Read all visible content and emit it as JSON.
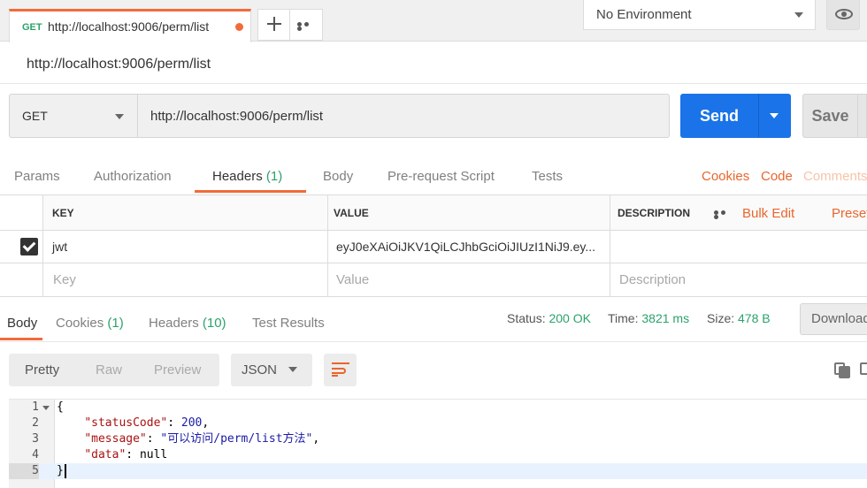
{
  "top_tabs": {
    "active_tab": {
      "method": "GET",
      "url": "http://localhost:9006/perm/list",
      "unsaved": true
    },
    "environment": {
      "selected": "No Environment"
    }
  },
  "request": {
    "title": "http://localhost:9006/perm/list",
    "method": "GET",
    "url": "http://localhost:9006/perm/list",
    "send_label": "Send",
    "save_label": "Save"
  },
  "request_tabs": {
    "items": [
      {
        "label": "Params",
        "count": ""
      },
      {
        "label": "Authorization",
        "count": ""
      },
      {
        "label": "Headers",
        "count": "(1)"
      },
      {
        "label": "Body",
        "count": ""
      },
      {
        "label": "Pre-request Script",
        "count": ""
      },
      {
        "label": "Tests",
        "count": ""
      }
    ],
    "active": "Headers",
    "links": {
      "cookies": "Cookies",
      "code": "Code",
      "comments": "Comments"
    }
  },
  "headers_table": {
    "columns": {
      "key": "KEY",
      "value": "VALUE",
      "description": "DESCRIPTION"
    },
    "bulk_edit": "Bulk Edit",
    "presets": "Presets",
    "rows": [
      {
        "checked": true,
        "key": "jwt",
        "value": "eyJ0eXAiOiJKV1QiLCJhbGciOiJIUzI1NiJ9.ey...",
        "description": ""
      }
    ],
    "placeholders": {
      "key": "Key",
      "value": "Value",
      "description": "Description"
    }
  },
  "response": {
    "tabs": [
      {
        "label": "Body",
        "count": ""
      },
      {
        "label": "Cookies",
        "count": "(1)"
      },
      {
        "label": "Headers",
        "count": "(10)"
      },
      {
        "label": "Test Results",
        "count": ""
      }
    ],
    "active": "Body",
    "status_label": "Status:",
    "status_value": "200 OK",
    "time_label": "Time:",
    "time_value": "3821 ms",
    "size_label": "Size:",
    "size_value": "478 B",
    "download_label": "Download",
    "view_modes": [
      "Pretty",
      "Raw",
      "Preview"
    ],
    "active_view": "Pretty",
    "format": "JSON",
    "code": {
      "line_numbers": [
        "1",
        "2",
        "3",
        "4",
        "5"
      ],
      "open_brace": "{",
      "status_key": "\"statusCode\"",
      "status_val": "200",
      "message_key": "\"message\"",
      "message_val": "\"可以访问/perm/list方法\"",
      "data_key": "\"data\"",
      "data_val": "null",
      "close_brace": "}"
    }
  },
  "colors": {
    "accent_orange": "#f26b3a",
    "send_blue": "#1a73e8",
    "success_green": "#2aa36b"
  }
}
